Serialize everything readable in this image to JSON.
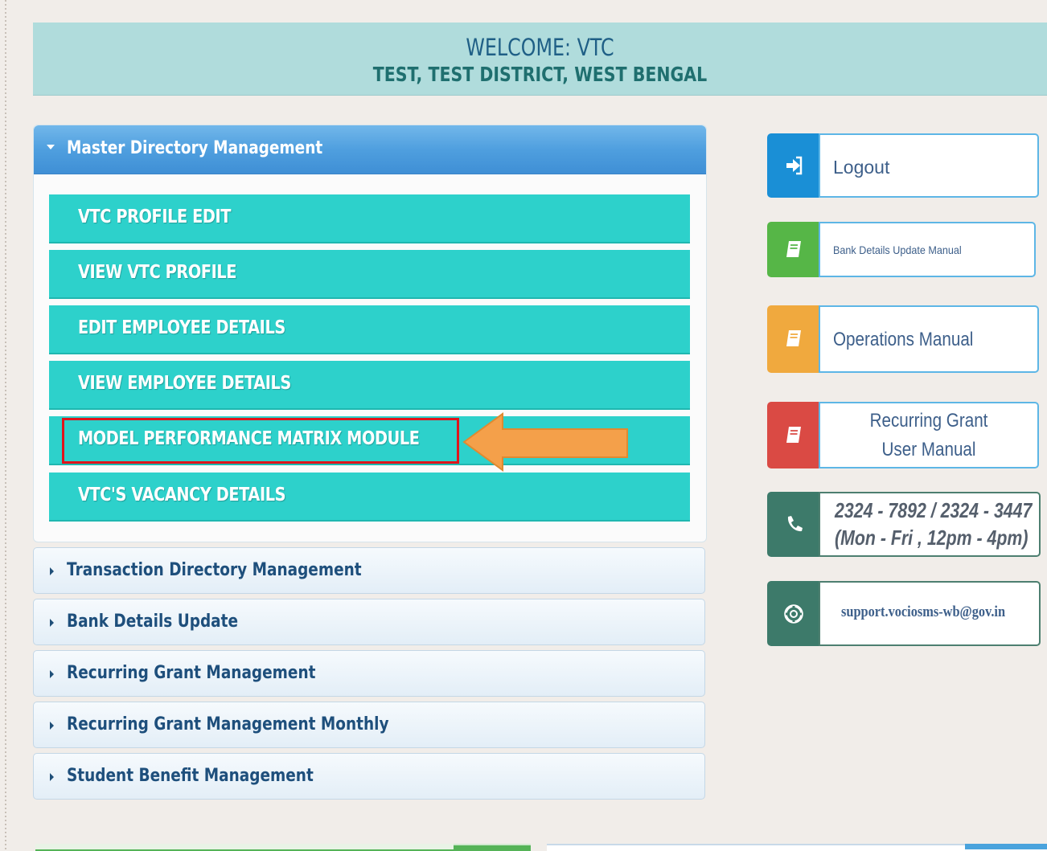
{
  "banner": {
    "welcome": "WELCOME: VTC",
    "location": "TEST, TEST DISTRICT, WEST BENGAL"
  },
  "master_panel": {
    "title": "Master Directory Management",
    "items": [
      "VTC PROFILE EDIT",
      "VIEW VTC PROFILE",
      "EDIT EMPLOYEE DETAILS",
      "VIEW EMPLOYEE DETAILS",
      "MODEL PERFORMANCE MATRIX MODULE",
      "VTC'S VACANCY DETAILS"
    ]
  },
  "accordion": [
    "Transaction Directory Management",
    "Bank Details Update",
    "Recurring Grant Management",
    "Recurring Grant Management Monthly",
    "Student Benefit Management"
  ],
  "sidebar": {
    "logout": "Logout",
    "bank_manual": "Bank Details Update Manual",
    "operations_manual": "Operations Manual",
    "recurring_manual_line1": "Recurring Grant",
    "recurring_manual_line2": "User Manual",
    "phone_line1": "2324 - 7892 / 2324 - 3447",
    "phone_line2": "(Mon - Fri , 12pm - 4pm)",
    "email": "support.vociosms-wb@gov.in"
  },
  "colors": {
    "banner_bg": "#b0dcdc",
    "header_blue": "#4f9fdf",
    "menu_teal": "#2dd1cb",
    "highlight_red": "#e0141b",
    "arrow_orange": "#f4a04a",
    "logout_blue": "#1a8fd6",
    "manual_green": "#56b647",
    "manual_orange": "#f0a93e",
    "manual_red": "#da4a44",
    "contact_teal": "#3d7a6a"
  }
}
